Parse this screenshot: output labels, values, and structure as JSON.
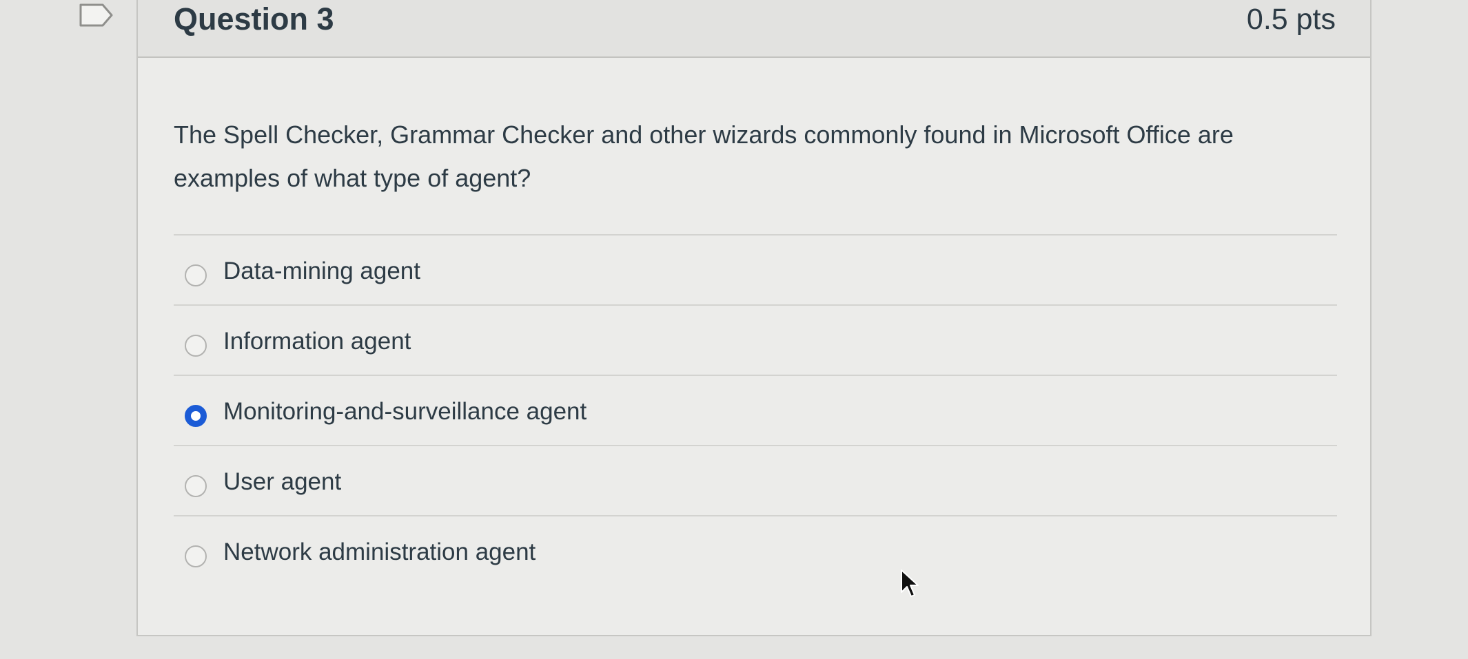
{
  "question": {
    "title": "Question 3",
    "points": "0.5 pts",
    "text": "The Spell Checker, Grammar Checker and other wizards commonly found in Microsoft Office are examples of what type of agent?"
  },
  "answers": [
    {
      "label": "Data-mining agent",
      "selected": false
    },
    {
      "label": "Information agent",
      "selected": false
    },
    {
      "label": "Monitoring-and-surveillance agent",
      "selected": true
    },
    {
      "label": "User agent",
      "selected": false
    },
    {
      "label": "Network administration agent",
      "selected": false
    }
  ],
  "icons": {
    "bookmark": "bookmark-flag-icon",
    "cursor": "mouse-pointer-icon"
  },
  "colors": {
    "selected_radio": "#1b5bd6",
    "text": "#2d3b45"
  }
}
